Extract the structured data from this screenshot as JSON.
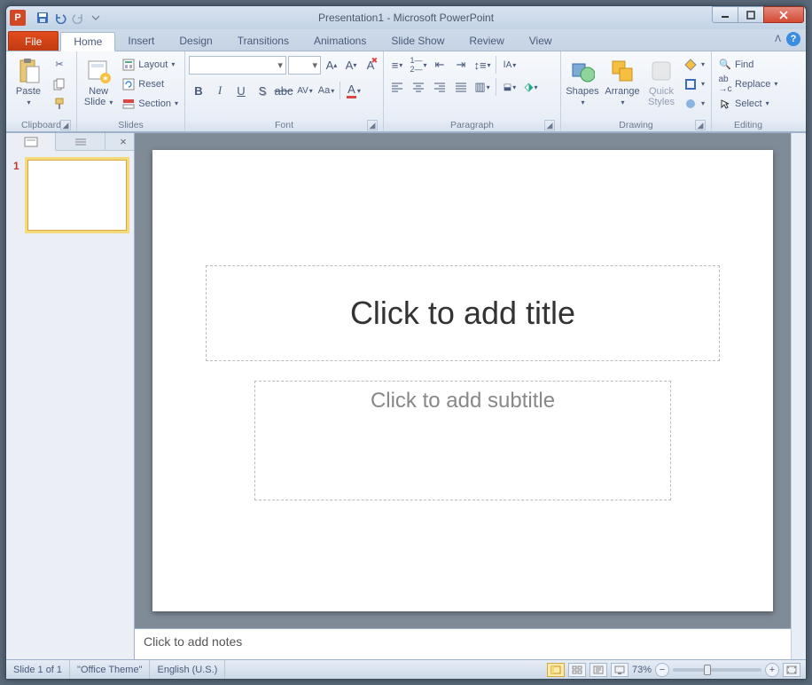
{
  "title": "Presentation1 - Microsoft PowerPoint",
  "tabs": {
    "file": "File",
    "items": [
      "Home",
      "Insert",
      "Design",
      "Transitions",
      "Animations",
      "Slide Show",
      "Review",
      "View"
    ],
    "active": "Home"
  },
  "ribbon": {
    "clipboard": {
      "label": "Clipboard",
      "paste": "Paste"
    },
    "slides": {
      "label": "Slides",
      "newslide": "New\nSlide",
      "layout": "Layout",
      "reset": "Reset",
      "section": "Section"
    },
    "font": {
      "label": "Font"
    },
    "paragraph": {
      "label": "Paragraph"
    },
    "drawing": {
      "label": "Drawing",
      "shapes": "Shapes",
      "arrange": "Arrange",
      "quick": "Quick\nStyles"
    },
    "editing": {
      "label": "Editing",
      "find": "Find",
      "replace": "Replace",
      "select": "Select"
    }
  },
  "thumb": {
    "num": "1"
  },
  "slide": {
    "title_placeholder": "Click to add title",
    "subtitle_placeholder": "Click to add subtitle"
  },
  "notes": "Click to add notes",
  "status": {
    "slide": "Slide 1 of 1",
    "theme": "\"Office Theme\"",
    "lang": "English (U.S.)",
    "zoom": "73%"
  }
}
